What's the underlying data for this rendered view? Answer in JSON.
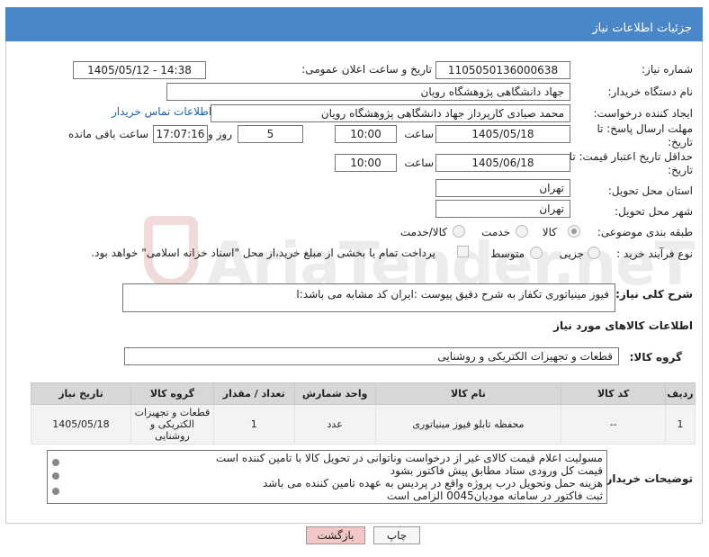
{
  "header": {
    "title": "جزئیات اطلاعات نیاز"
  },
  "form": {
    "need_number_label": "شماره نیاز:",
    "need_number": "1105050136000638",
    "announce_label": "تاریخ و ساعت اعلان عمومی:",
    "announce_value": "1405/05/12 - 14:38",
    "buyer_org_label": "نام دستگاه خریدار:",
    "buyer_org": "جهاد دانشگاهی پژوهشگاه رویان",
    "creator_label": "ایجاد کننده درخواست:",
    "creator": "محمد صیادی کارپرداز جهاد دانشگاهی پژوهشگاه رویان",
    "contact_link": "اطلاعات تماس خریدار",
    "reply_deadline_label": "مهلت ارسال پاسخ: تا تاریخ:",
    "reply_date": "1405/05/18",
    "time_label": "ساعت",
    "reply_time": "10:00",
    "days_value": "5",
    "days_label": "روز و",
    "remaining_time": "17:07:16",
    "remaining_label": "ساعت باقی مانده",
    "price_validity_label": "حداقل تاریخ اعتبار قیمت: تا تاریخ:",
    "price_date": "1405/06/18",
    "price_time": "10:00",
    "province_label": "استان محل تحویل:",
    "province": "تهران",
    "city_label": "شهر محل تحویل:",
    "city": "تهران",
    "category_label": "طبقه بندی موضوعی:",
    "category_options": [
      "کالا",
      "خدمت",
      "کالا/خدمت"
    ],
    "process_label": "نوع فرآیند خرید :",
    "process_options": [
      "جزیی",
      "متوسط"
    ],
    "payment_note": "پرداخت تمام یا بخشی از مبلغ خرید،از محل \"اسناد خزانه اسلامی\" خواهد بود."
  },
  "description": {
    "label": "شرح کلی نیاز:",
    "text": "فیوز مینیاتوری تکفاز به شرح دقیق پیوست :ایران کد مشابه می باشد:ا"
  },
  "goods": {
    "section_title": "اطلاعات کالاهای مورد نیاز",
    "group_label": "گروه کالا:",
    "group_value": "قطعات و تجهیزات الکتریکی و روشنایی"
  },
  "table": {
    "headers": [
      "ردیف",
      "کد کالا",
      "نام کالا",
      "واحد شمارش",
      "تعداد / مقدار",
      "گروه کالا",
      "تاریخ نیاز"
    ],
    "rows": [
      {
        "row": "1",
        "code": "--",
        "name": "محفظه تابلو فیوز مینیاتوری",
        "unit": "عدد",
        "qty": "1",
        "group": "قطعات و تجهیزات الکتریکی و روشنایی",
        "date": "1405/05/18"
      }
    ]
  },
  "buyer_notes": {
    "label": "توضیحات خریدار:",
    "lines": [
      "مسولیت اعلام  قیمت کالای غیر از درخواست وناتوانی در تحویل کالا با تامین کننده است",
      "قیمت کل ورودی ستاد مطابق پیش فاکتور بشود",
      "هزینه حمل وتحویل درب پروژه واقع در پردیس به عهده تامین کننده می باشد",
      "ثبت فاکتور در سامانه مودیان0045 الزامی است"
    ]
  },
  "buttons": {
    "print": "چاپ",
    "back": "بازگشت"
  },
  "watermark": "AriaTender.neT",
  "colors": {
    "header": "#4a87c9",
    "back_button": "#f4c7c7"
  }
}
